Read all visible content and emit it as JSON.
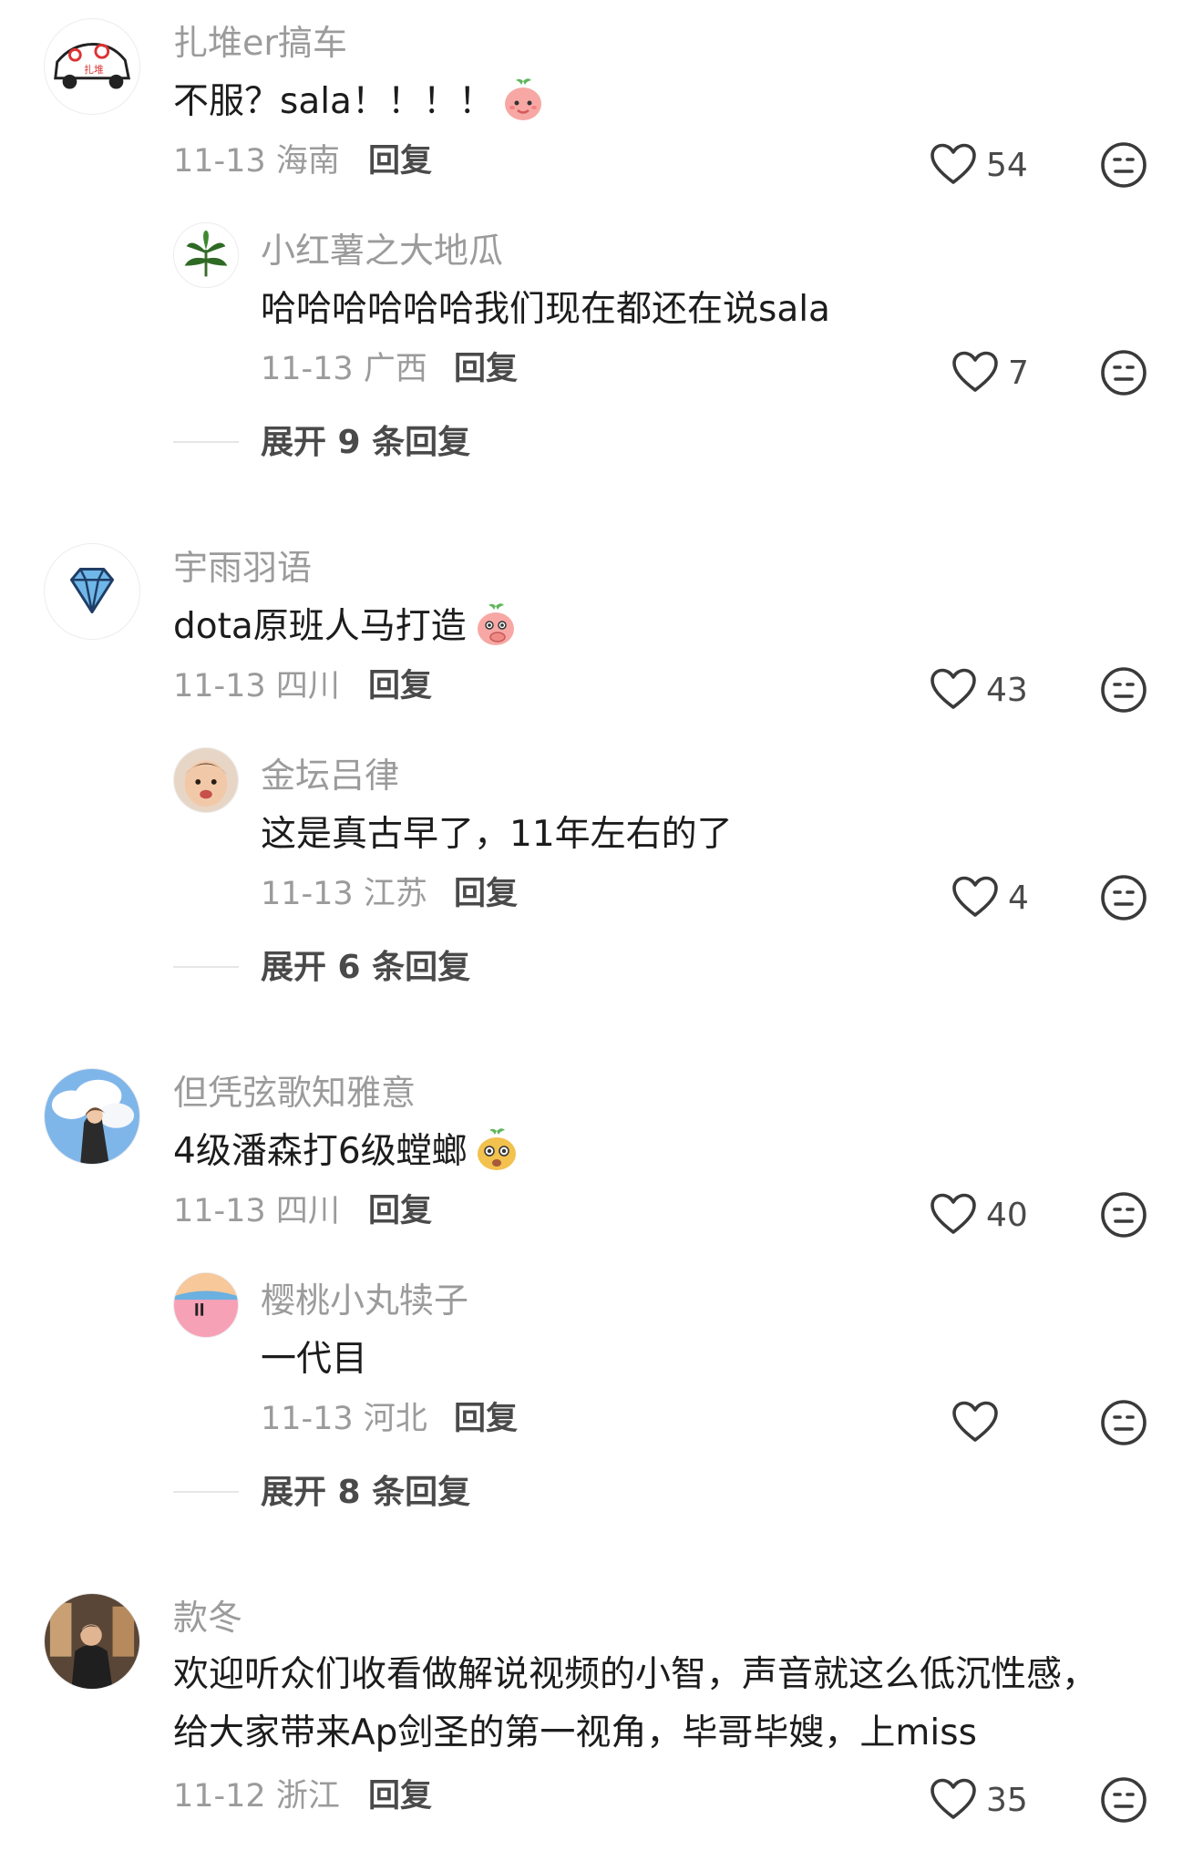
{
  "threads": [
    {
      "comment": {
        "username": "扎堆er搞车",
        "text": "不服？sala！！！！",
        "emoji": "peach-smile-emoji",
        "date": "11-13",
        "location": "海南",
        "reply_label": "回复",
        "likes": "54"
      },
      "reply": {
        "username": "小红薯之大地瓜",
        "text": "哈哈哈哈哈哈我们现在都还在说sala",
        "date": "11-13",
        "location": "广西",
        "reply_label": "回复",
        "likes": "7"
      },
      "expand_label": "展开 9 条回复"
    },
    {
      "comment": {
        "username": "宇雨羽语",
        "text": "dota原班人马打造",
        "emoji": "peach-shy-emoji",
        "date": "11-13",
        "location": "四川",
        "reply_label": "回复",
        "likes": "43"
      },
      "reply": {
        "username": "金坛吕律",
        "text": "这是真古早了，11年左右的了",
        "date": "11-13",
        "location": "江苏",
        "reply_label": "回复",
        "likes": "4"
      },
      "expand_label": "展开 6 条回复"
    },
    {
      "comment": {
        "username": "但凭弦歌知雅意",
        "text": "4级潘森打6级螳螂",
        "emoji": "sweet-potato-emoji",
        "date": "11-13",
        "location": "四川",
        "reply_label": "回复",
        "likes": "40"
      },
      "reply": {
        "username": "樱桃小丸犊子",
        "text": "一代目",
        "date": "11-13",
        "location": "河北",
        "reply_label": "回复",
        "likes": ""
      },
      "expand_label": "展开 8 条回复"
    },
    {
      "comment": {
        "username": "款冬",
        "text": "欢迎听众们收看做解说视频的小智，声音就这么低沉性感，给大家带来Ap剑圣的第一视角，毕哥毕嫂，上miss",
        "date": "11-12",
        "location": "浙江",
        "reply_label": "回复",
        "likes": "35"
      }
    }
  ],
  "colors": {
    "username": "#9b9b9b",
    "text": "#1c1c1c",
    "meta": "#9b9b9b",
    "action": "#4a4a4a"
  },
  "icons": {
    "like": "heart-outline-icon",
    "dislike": "neutral-face-icon"
  }
}
